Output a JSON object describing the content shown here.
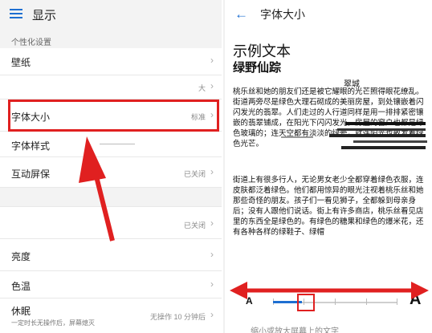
{
  "left": {
    "title": "显示",
    "section_label": "个性化设置",
    "rows": [
      {
        "label": "壁纸",
        "value": ""
      },
      {
        "label": "",
        "value": "大"
      },
      {
        "label": "字体大小",
        "value": "标准"
      },
      {
        "label": "字体样式",
        "value": ""
      },
      {
        "label": "互动屏保",
        "value": "已关闭"
      },
      {
        "label": "",
        "value": ""
      },
      {
        "label": "",
        "value": "已关闭"
      },
      {
        "label": "亮度",
        "value": ""
      },
      {
        "label": "色温",
        "value": ""
      },
      {
        "label": "休眠",
        "value": "无操作 10 分钟后",
        "sub": "一定时长无操作后，屏幕熄灭"
      }
    ]
  },
  "right": {
    "title": "字体大小",
    "sample_title": "示例文本",
    "story_title": "绿野仙踪",
    "chapter": "翠城",
    "para1": "桃乐丝和她的朋友们还是被它耀眼的光芒照得眼花缭乱。街道两旁尽是绿色大理石砌成的美丽房屋，到处镶嵌着闪闪发光的翡翠。人们走过的人行道同样是用一排排紧密镶嵌的翡翠铺成，在阳光下闪闪发光。房屋的窗户也都是绿色玻璃的；连天空都有淡淡的绿晕，就连阳光也散发着绿色光芒。",
    "para2": "街道上有很多行人，无论男女老少全都穿着绿色衣服，连皮肤都泛着绿色。他们都用惊异的眼光注视着桃乐丝和她那些奇怪的朋友。孩子们一看见狮子，全都躲到母亲身后；没有人跟他们说话。街上有许多商店，桃乐丝看见店里的东西全是绿色的。有绿色的糖果和绿色的爆米花，还有各种各样的绿鞋子、绿帽",
    "small_a": "A",
    "large_a": "A",
    "hint": "缩小或放大屏幕上的文字"
  },
  "colors": {
    "accent": "#1e6fd1",
    "highlight": "#e02020"
  },
  "icons": [
    "menu-icon",
    "back-arrow-icon",
    "chevron-right-icon"
  ]
}
